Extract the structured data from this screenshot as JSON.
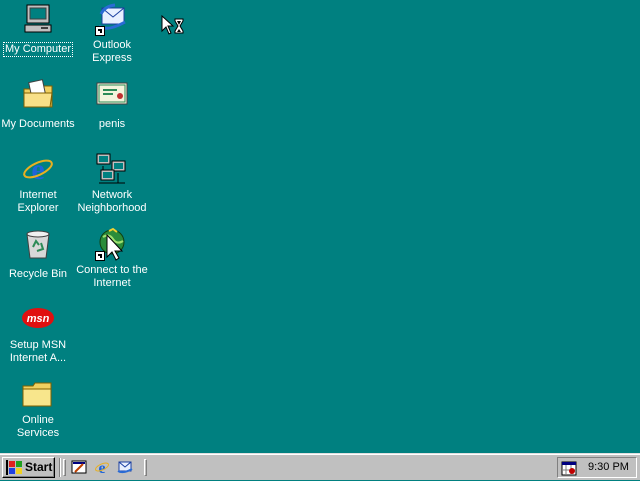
{
  "desktop": {
    "background": "#008080",
    "icons": [
      {
        "label": "My Computer",
        "icon": "my-computer-icon"
      },
      {
        "label": "Outlook\nExpress",
        "icon": "outlook-express-icon"
      },
      {
        "label": "My Documents",
        "icon": "my-documents-icon"
      },
      {
        "label": "penis",
        "icon": "certificate-document-icon"
      },
      {
        "label": "Internet\nExplorer",
        "icon": "internet-explorer-icon"
      },
      {
        "label": "Network\nNeighborhood",
        "icon": "network-neighborhood-icon"
      },
      {
        "label": "Recycle Bin",
        "icon": "recycle-bin-icon"
      },
      {
        "label": "Connect to the\nInternet",
        "icon": "connect-internet-icon"
      },
      {
        "label": "Setup MSN\nInternet A...",
        "icon": "msn-icon"
      },
      {
        "label": "Online\nServices",
        "icon": "folder-icon"
      }
    ]
  },
  "taskbar": {
    "start_label": "Start",
    "quick_launch": [
      "show-desktop-icon",
      "internet-explorer-icon",
      "outlook-express-icon"
    ],
    "clock": "9:30 PM",
    "tray_icon": "scheduler-tray-icon"
  }
}
